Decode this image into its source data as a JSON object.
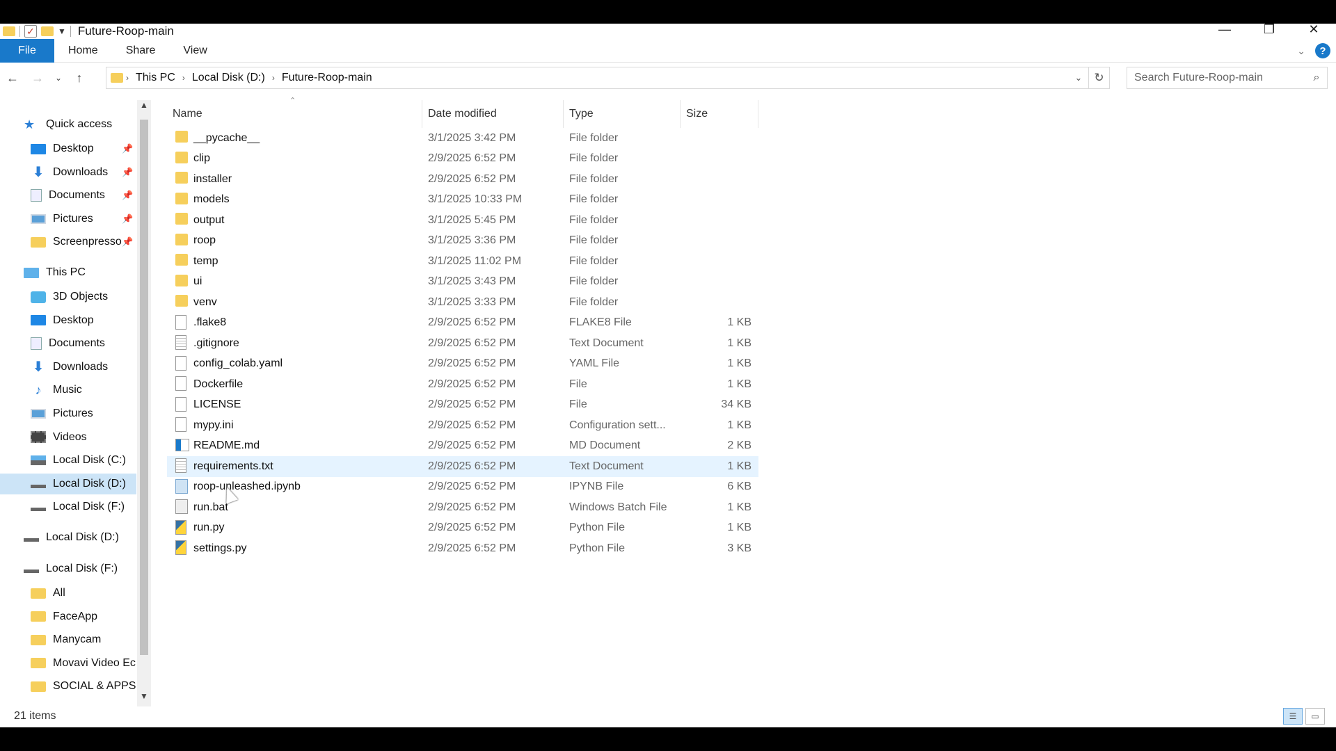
{
  "window": {
    "title": "Future-Roop-main",
    "controls": {
      "minimize": "—",
      "restore": "❐",
      "close": "✕"
    }
  },
  "ribbon": {
    "tabs": [
      "File",
      "Home",
      "Share",
      "View"
    ],
    "help_label": "?"
  },
  "address": {
    "crumbs": [
      "This PC",
      "Local Disk (D:)",
      "Future-Roop-main"
    ],
    "search_placeholder": "Search Future-Roop-main"
  },
  "nav_pane": {
    "items": [
      {
        "label": "Quick access",
        "icon": "star-icon",
        "level": 0,
        "pinned": false
      },
      {
        "label": "Desktop",
        "icon": "desktop-icon",
        "level": 1,
        "pinned": true
      },
      {
        "label": "Downloads",
        "icon": "download-icon",
        "level": 1,
        "pinned": true
      },
      {
        "label": "Documents",
        "icon": "documents-icon",
        "level": 1,
        "pinned": true
      },
      {
        "label": "Pictures",
        "icon": "pictures-icon",
        "level": 1,
        "pinned": true
      },
      {
        "label": "Screenpresso",
        "icon": "folder-icon",
        "level": 1,
        "pinned": true
      },
      {
        "label": "This PC",
        "icon": "computer-icon",
        "level": 0,
        "pinned": false
      },
      {
        "label": "3D Objects",
        "icon": "3d-objects-icon",
        "level": 1,
        "pinned": false
      },
      {
        "label": "Desktop",
        "icon": "desktop-icon",
        "level": 1,
        "pinned": false
      },
      {
        "label": "Documents",
        "icon": "documents-icon",
        "level": 1,
        "pinned": false
      },
      {
        "label": "Downloads",
        "icon": "download-icon",
        "level": 1,
        "pinned": false
      },
      {
        "label": "Music",
        "icon": "music-icon",
        "level": 1,
        "pinned": false
      },
      {
        "label": "Pictures",
        "icon": "pictures-icon",
        "level": 1,
        "pinned": false
      },
      {
        "label": "Videos",
        "icon": "videos-icon",
        "level": 1,
        "pinned": false
      },
      {
        "label": "Local Disk (C:)",
        "icon": "system-drive-icon",
        "level": 1,
        "pinned": false
      },
      {
        "label": "Local Disk (D:)",
        "icon": "drive-icon",
        "level": 1,
        "pinned": false,
        "selected": true
      },
      {
        "label": "Local Disk (F:)",
        "icon": "drive-icon",
        "level": 1,
        "pinned": false
      },
      {
        "label": "Local Disk (D:)",
        "icon": "drive-icon",
        "level": 0,
        "pinned": false
      },
      {
        "label": "Local Disk (F:)",
        "icon": "drive-icon",
        "level": 0,
        "pinned": false
      },
      {
        "label": "All",
        "icon": "folder-icon",
        "level": 1,
        "pinned": false
      },
      {
        "label": "FaceApp",
        "icon": "folder-icon",
        "level": 1,
        "pinned": false
      },
      {
        "label": "Manycam",
        "icon": "folder-icon",
        "level": 1,
        "pinned": false
      },
      {
        "label": "Movavi Video Ec",
        "icon": "folder-icon",
        "level": 1,
        "pinned": false
      },
      {
        "label": "SOCIAL & APPS",
        "icon": "folder-icon",
        "level": 1,
        "pinned": false
      }
    ]
  },
  "file_list": {
    "columns": [
      "Name",
      "Date modified",
      "Type",
      "Size"
    ],
    "rows": [
      {
        "name": "__pycache__",
        "date": "3/1/2025 3:42 PM",
        "type": "File folder",
        "size": "",
        "icon": "folder"
      },
      {
        "name": "clip",
        "date": "2/9/2025 6:52 PM",
        "type": "File folder",
        "size": "",
        "icon": "folder"
      },
      {
        "name": "installer",
        "date": "2/9/2025 6:52 PM",
        "type": "File folder",
        "size": "",
        "icon": "folder"
      },
      {
        "name": "models",
        "date": "3/1/2025 10:33 PM",
        "type": "File folder",
        "size": "",
        "icon": "folder"
      },
      {
        "name": "output",
        "date": "3/1/2025 5:45 PM",
        "type": "File folder",
        "size": "",
        "icon": "folder"
      },
      {
        "name": "roop",
        "date": "3/1/2025 3:36 PM",
        "type": "File folder",
        "size": "",
        "icon": "folder"
      },
      {
        "name": "temp",
        "date": "3/1/2025 11:02 PM",
        "type": "File folder",
        "size": "",
        "icon": "folder"
      },
      {
        "name": "ui",
        "date": "3/1/2025 3:43 PM",
        "type": "File folder",
        "size": "",
        "icon": "folder"
      },
      {
        "name": "venv",
        "date": "3/1/2025 3:33 PM",
        "type": "File folder",
        "size": "",
        "icon": "folder"
      },
      {
        "name": ".flake8",
        "date": "2/9/2025 6:52 PM",
        "type": "FLAKE8 File",
        "size": "1 KB",
        "icon": "file"
      },
      {
        "name": ".gitignore",
        "date": "2/9/2025 6:52 PM",
        "type": "Text Document",
        "size": "1 KB",
        "icon": "text"
      },
      {
        "name": "config_colab.yaml",
        "date": "2/9/2025 6:52 PM",
        "type": "YAML File",
        "size": "1 KB",
        "icon": "file"
      },
      {
        "name": "Dockerfile",
        "date": "2/9/2025 6:52 PM",
        "type": "File",
        "size": "1 KB",
        "icon": "file"
      },
      {
        "name": "LICENSE",
        "date": "2/9/2025 6:52 PM",
        "type": "File",
        "size": "34 KB",
        "icon": "file"
      },
      {
        "name": "mypy.ini",
        "date": "2/9/2025 6:52 PM",
        "type": "Configuration sett...",
        "size": "1 KB",
        "icon": "cfg"
      },
      {
        "name": "README.md",
        "date": "2/9/2025 6:52 PM",
        "type": "MD Document",
        "size": "2 KB",
        "icon": "md"
      },
      {
        "name": "requirements.txt",
        "date": "2/9/2025 6:52 PM",
        "type": "Text Document",
        "size": "1 KB",
        "icon": "text",
        "hover": true
      },
      {
        "name": "roop-unleashed.ipynb",
        "date": "2/9/2025 6:52 PM",
        "type": "IPYNB File",
        "size": "6 KB",
        "icon": "nb"
      },
      {
        "name": "run.bat",
        "date": "2/9/2025 6:52 PM",
        "type": "Windows Batch File",
        "size": "1 KB",
        "icon": "bat"
      },
      {
        "name": "run.py",
        "date": "2/9/2025 6:52 PM",
        "type": "Python File",
        "size": "1 KB",
        "icon": "py"
      },
      {
        "name": "settings.py",
        "date": "2/9/2025 6:52 PM",
        "type": "Python File",
        "size": "3 KB",
        "icon": "py"
      }
    ]
  },
  "status": {
    "item_count": "21 items"
  },
  "colors": {
    "accent": "#1979ca",
    "selection": "#cce4f7",
    "hover": "#e5f3ff",
    "folder": "#f6cf5c"
  }
}
